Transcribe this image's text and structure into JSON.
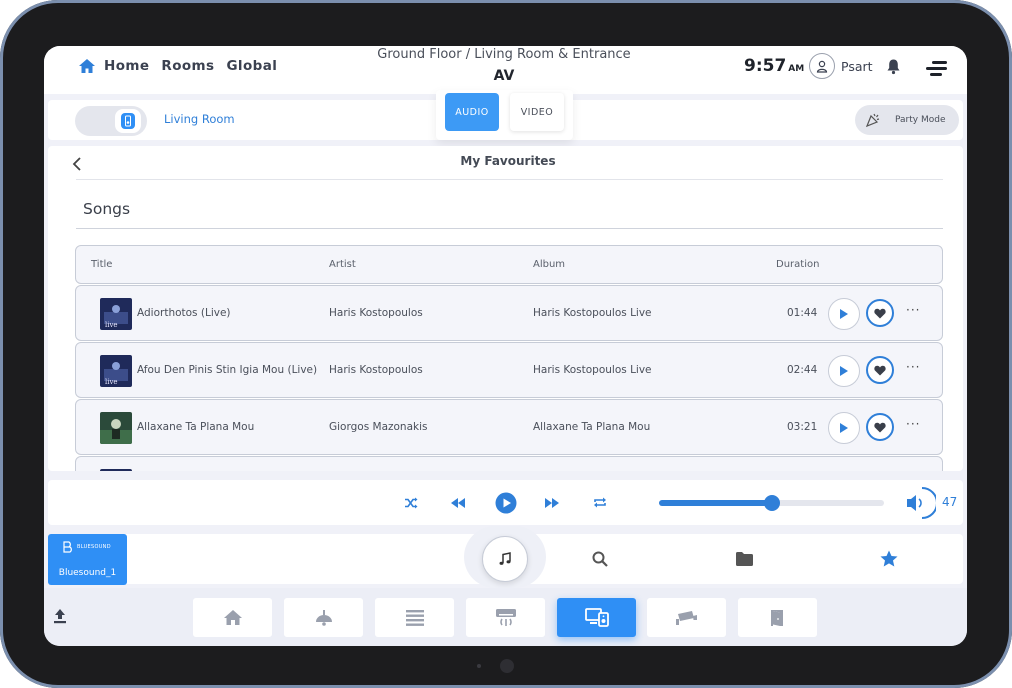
{
  "nav": {
    "home": "Home",
    "rooms": "Rooms",
    "global": "Global"
  },
  "header": {
    "location": "Ground Floor / Living Room & Entrance",
    "section": "AV",
    "time": "9:57",
    "ampm": "AM",
    "user": "Psart"
  },
  "roombar": {
    "room_label": "Living Room",
    "tab_audio": "AUDIO",
    "tab_video": "VIDEO",
    "party_mode": "Party Mode"
  },
  "panel": {
    "title": "My Favourites",
    "songs_heading": "Songs",
    "columns": {
      "title": "Title",
      "artist": "Artist",
      "album": "Album",
      "duration": "Duration"
    },
    "rows": [
      {
        "title": "Adiorthotos (Live)",
        "artist": "Haris Kostopoulos",
        "album": "Haris Kostopoulos Live",
        "duration": "01:44"
      },
      {
        "title": "Afou Den Pinis Stin Igia Mou (Live)",
        "artist": "Haris Kostopoulos",
        "album": "Haris Kostopoulos Live",
        "duration": "02:44"
      },
      {
        "title": "Allaxane Ta Plana Mou",
        "artist": "Giorgos Mazonakis",
        "album": "Allaxane Ta Plana Mou",
        "duration": "03:21"
      }
    ]
  },
  "player": {
    "progress_fraction": 0.5,
    "volume": "47"
  },
  "source": {
    "name": "Bluesound_1",
    "logo_text": "BLUESOUND"
  },
  "colors": {
    "accent": "#2f8ff5",
    "accent_dark": "#2f7fd8",
    "background": "#f0f1f8"
  },
  "icons": {
    "home": "home-icon",
    "bell": "bell-icon",
    "menu": "menu-icon",
    "play": "play-icon",
    "heart": "heart-icon",
    "shuffle": "shuffle-icon",
    "repeat": "repeat-icon",
    "volume": "volume-icon",
    "music": "music-note-icon",
    "search": "search-icon",
    "folder": "folder-icon",
    "star": "star-icon"
  }
}
